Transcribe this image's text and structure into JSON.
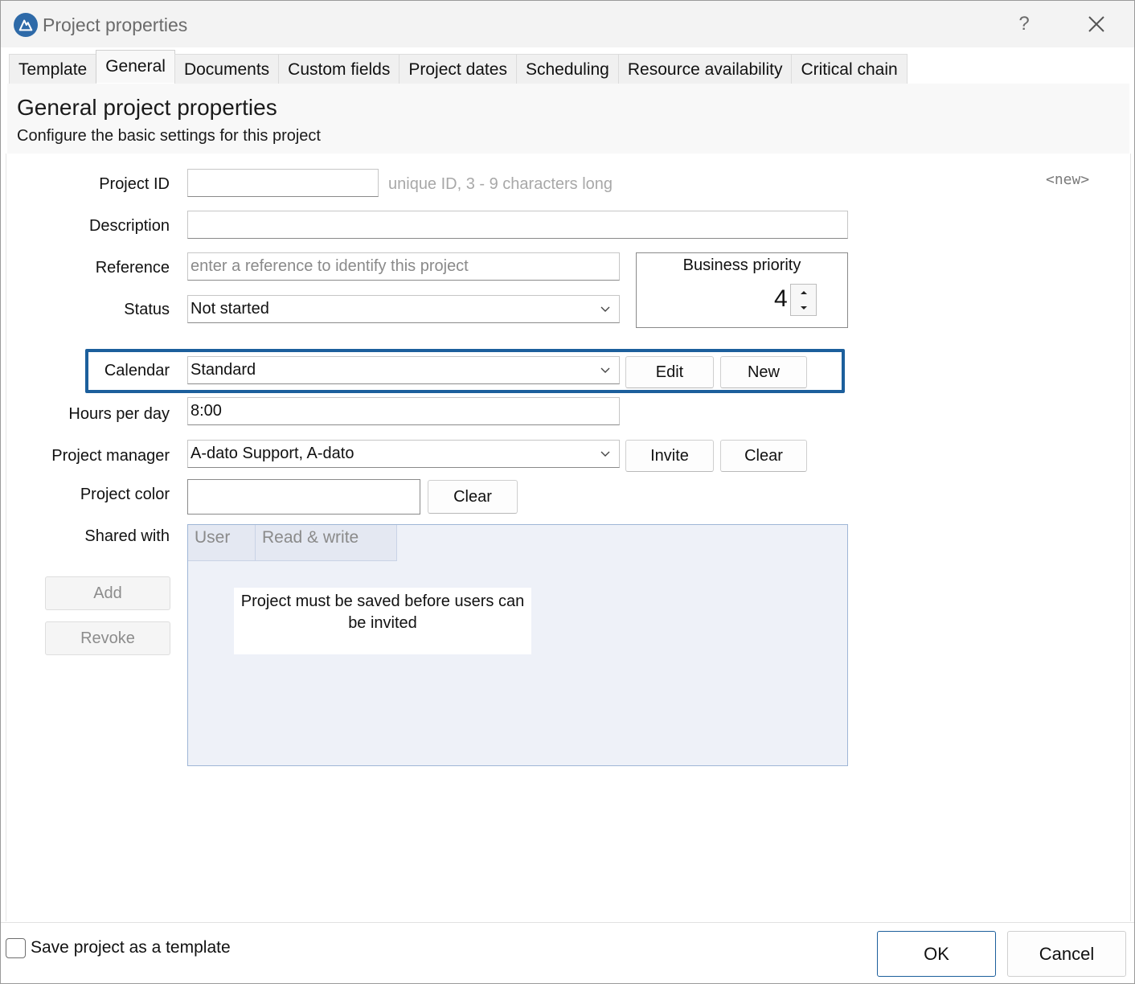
{
  "window": {
    "title": "Project properties",
    "help_label": "?",
    "app_icon": "adato-logo-icon",
    "close_icon": "close-icon"
  },
  "tabs": [
    {
      "label": "Template",
      "active": false
    },
    {
      "label": "General",
      "active": true
    },
    {
      "label": "Documents",
      "active": false
    },
    {
      "label": "Custom fields",
      "active": false
    },
    {
      "label": "Project dates",
      "active": false
    },
    {
      "label": "Scheduling",
      "active": false
    },
    {
      "label": "Resource availability",
      "active": false
    },
    {
      "label": "Critical chain",
      "active": false
    }
  ],
  "header": {
    "title": "General project properties",
    "subtitle": "Configure the basic settings for this project"
  },
  "form": {
    "new_tag": "<new>",
    "project_id": {
      "label": "Project ID",
      "value": "",
      "hint": "unique ID, 3 - 9 characters long"
    },
    "description": {
      "label": "Description",
      "value": ""
    },
    "reference": {
      "label": "Reference",
      "placeholder": "enter a reference to identify this project"
    },
    "status": {
      "label": "Status",
      "value": "Not started"
    },
    "business_priority": {
      "label": "Business priority",
      "value": "4"
    },
    "calendar": {
      "label": "Calendar",
      "value": "Standard",
      "edit_label": "Edit",
      "new_label": "New"
    },
    "hours_per_day": {
      "label": "Hours per day",
      "value": "8:00"
    },
    "project_manager": {
      "label": "Project manager",
      "value": "A-dato Support, A-dato",
      "invite_label": "Invite",
      "clear_label": "Clear"
    },
    "project_color": {
      "label": "Project color",
      "clear_label": "Clear"
    },
    "shared_with": {
      "label": "Shared with",
      "add_label": "Add",
      "revoke_label": "Revoke",
      "columns": [
        "User",
        "Read & write"
      ],
      "message": "Project must be saved before users can be invited"
    }
  },
  "footer": {
    "save_template_label": "Save project as a template",
    "save_template_checked": false,
    "ok_label": "OK",
    "cancel_label": "Cancel"
  },
  "colors": {
    "accent": "#1c5f9c",
    "highlight_border": "#1c5f9c",
    "grid_background": "#eef1f8"
  }
}
